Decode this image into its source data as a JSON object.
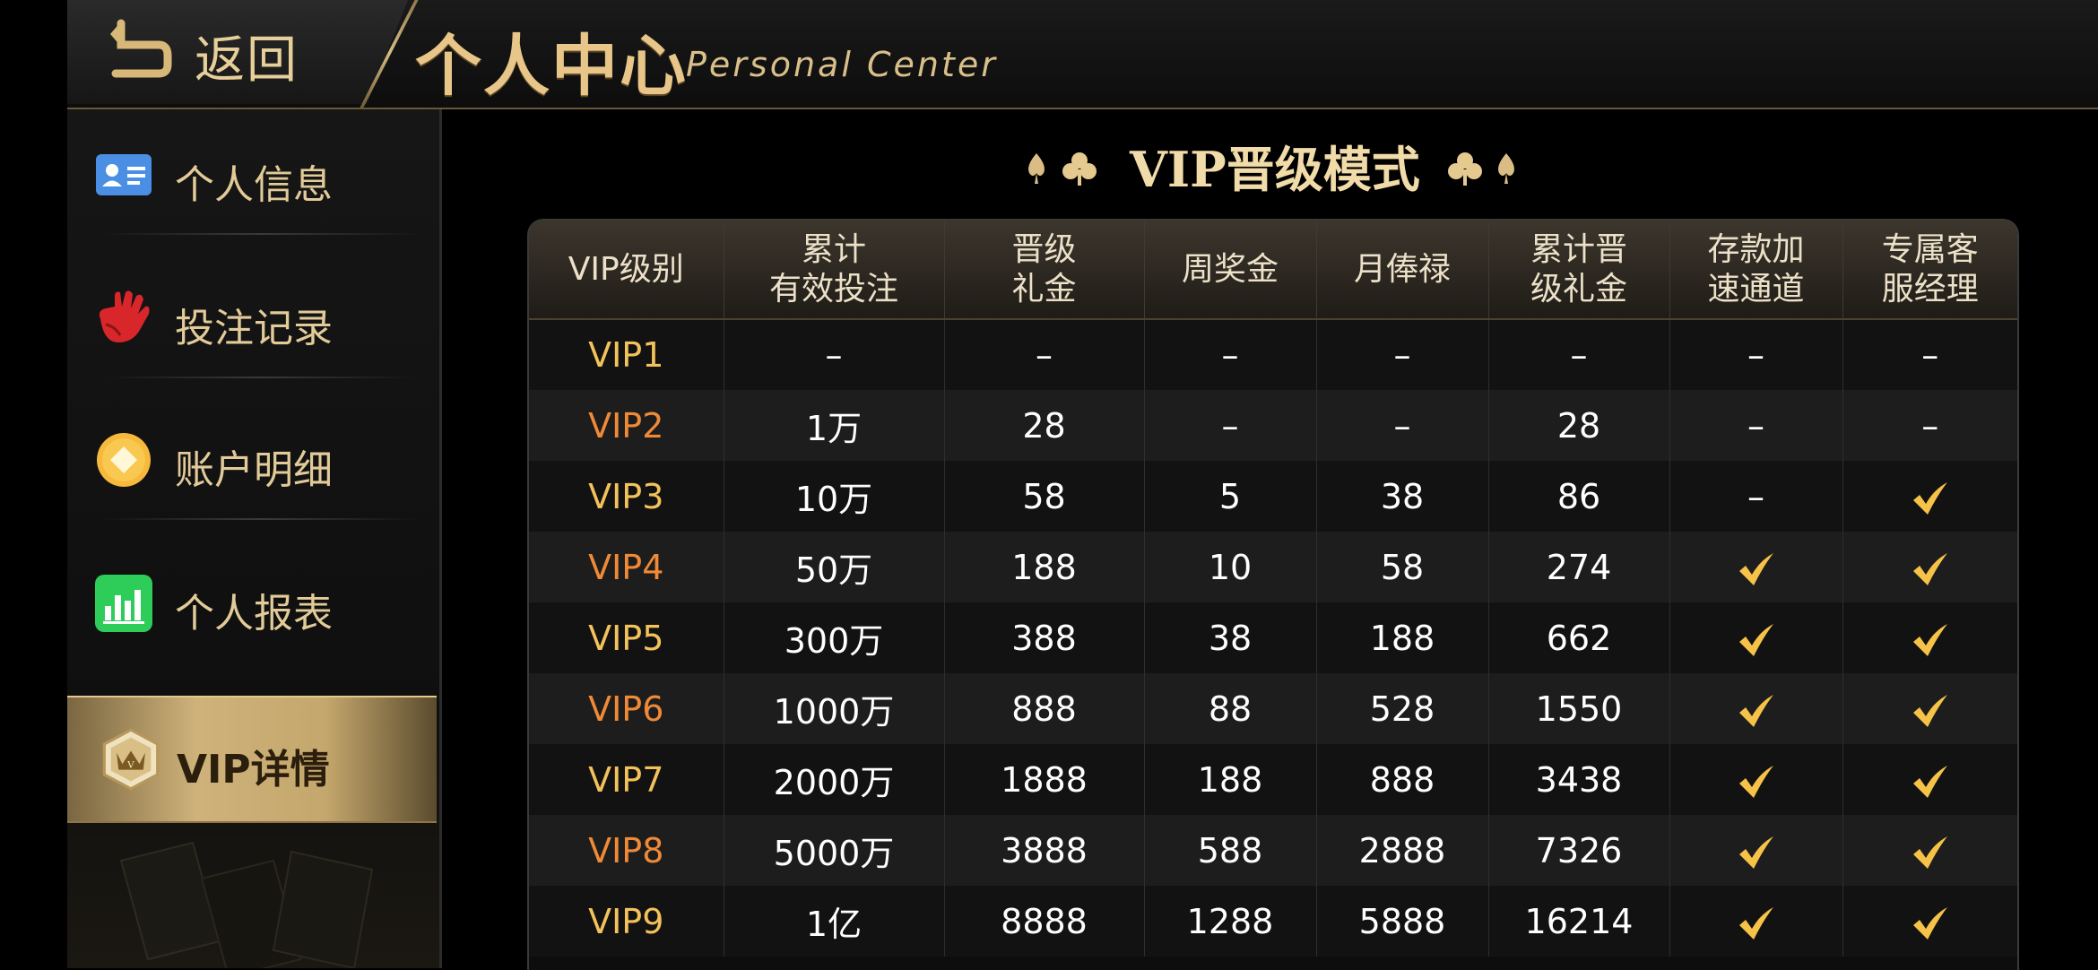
{
  "header": {
    "back_label": "返回",
    "title_cn": "个人中心",
    "title_en": "Personal Center"
  },
  "sidebar": {
    "items": [
      {
        "label": "个人信息",
        "icon": "id-card-icon"
      },
      {
        "label": "投注记录",
        "icon": "hand-icon"
      },
      {
        "label": "账户明细",
        "icon": "coin-icon"
      },
      {
        "label": "个人报表",
        "icon": "bar-chart-icon"
      },
      {
        "label": "VIP详情",
        "icon": "vip-crown-icon",
        "active": true
      }
    ]
  },
  "section": {
    "title": "VIP晋级模式"
  },
  "table": {
    "headers": [
      "VIP级别",
      "累计\n有效投注",
      "晋级\n礼金",
      "周奖金",
      "月俸禄",
      "累计晋\n级礼金",
      "存款加\n速通道",
      "专属客\n服经理"
    ],
    "rows": [
      [
        "VIP1",
        "–",
        "–",
        "–",
        "–",
        "–",
        "–",
        "–"
      ],
      [
        "VIP2",
        "1万",
        "28",
        "–",
        "–",
        "28",
        "–",
        "–"
      ],
      [
        "VIP3",
        "10万",
        "58",
        "5",
        "38",
        "86",
        "–",
        "check"
      ],
      [
        "VIP4",
        "50万",
        "188",
        "10",
        "58",
        "274",
        "check",
        "check"
      ],
      [
        "VIP5",
        "300万",
        "388",
        "38",
        "188",
        "662",
        "check",
        "check"
      ],
      [
        "VIP6",
        "1000万",
        "888",
        "88",
        "528",
        "1550",
        "check",
        "check"
      ],
      [
        "VIP7",
        "2000万",
        "1888",
        "188",
        "888",
        "3438",
        "check",
        "check"
      ],
      [
        "VIP8",
        "5000万",
        "3888",
        "588",
        "2888",
        "7326",
        "check",
        "check"
      ],
      [
        "VIP9",
        "1亿",
        "8888",
        "1288",
        "5888",
        "16214",
        "check",
        "check"
      ]
    ]
  },
  "colors": {
    "gold": "#e8c689",
    "level_yellow": "#f4c25a",
    "level_orange": "#f08a36",
    "check_gold": "#f6c248"
  }
}
